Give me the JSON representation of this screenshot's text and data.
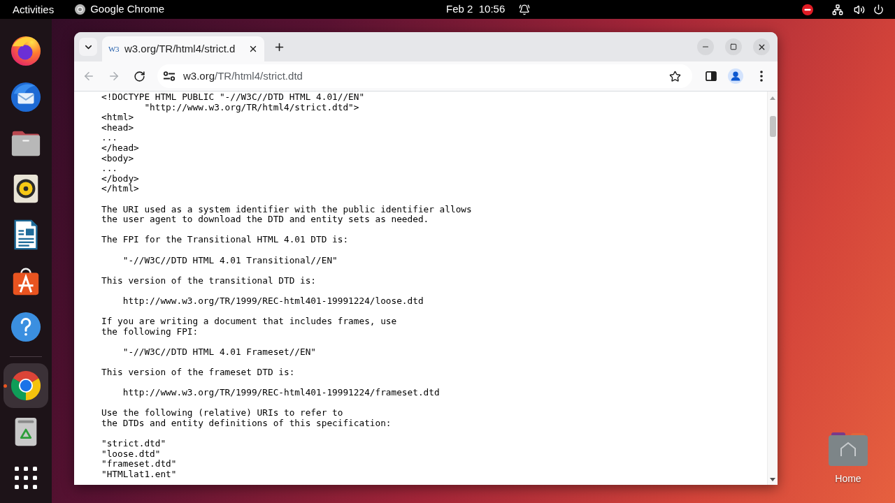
{
  "top_bar": {
    "activities": "Activities",
    "app_menu": "Google Chrome",
    "date": "Feb 2",
    "time": "10:56"
  },
  "dock": {
    "sections": [
      {
        "items": [
          {
            "kind": "fox_browser",
            "active": false
          },
          {
            "kind": "mail",
            "active": false
          },
          {
            "kind": "files",
            "active": false
          },
          {
            "kind": "music",
            "active": false
          },
          {
            "kind": "writer",
            "active": false
          },
          {
            "kind": "software",
            "active": false
          },
          {
            "kind": "help",
            "active": false
          }
        ]
      },
      {
        "items": [
          {
            "kind": "browser",
            "active": true
          },
          {
            "kind": "trash",
            "active": false
          },
          {
            "kind": "apps",
            "active": false
          }
        ]
      }
    ]
  },
  "browser": {
    "tabs": [
      {
        "favicon": "W3",
        "title": "w3.org/TR/html4/strict.d",
        "selected": true
      }
    ],
    "nav_buttons": [
      {
        "kind": "back",
        "disabled": true
      },
      {
        "kind": "forward",
        "disabled": true
      },
      {
        "kind": "reload",
        "disabled": false
      }
    ],
    "address_bar": {
      "host": "w3.org",
      "path": "/TR/html4/strict.dtd"
    },
    "document": {
      "blocks": [
        {
          "lines": [
            "<!DOCTYPE HTML PUBLIC \"-//W3C//DTD HTML 4.01//EN\"",
            "        \"http://www.w3.org/TR/html4/strict.dtd\">",
            "<html>",
            "<head>",
            "...",
            "</head>",
            "<body>",
            "...",
            "</body>",
            "</html>"
          ]
        },
        {
          "lines": [
            "The URI used as a system identifier with the public identifier allows",
            "the user agent to download the DTD and entity sets as needed."
          ]
        },
        {
          "lines": [
            "The FPI for the Transitional HTML 4.01 DTD is:"
          ]
        },
        {
          "lines": [
            "    \"-//W3C//DTD HTML 4.01 Transitional//EN\""
          ]
        },
        {
          "lines": [
            "This version of the transitional DTD is:"
          ]
        },
        {
          "lines": [
            "    http://www.w3.org/TR/1999/REC-html401-19991224/loose.dtd"
          ]
        },
        {
          "lines": [
            "If you are writing a document that includes frames, use",
            "the following FPI:"
          ]
        },
        {
          "lines": [
            "    \"-//W3C//DTD HTML 4.01 Frameset//EN\""
          ]
        },
        {
          "lines": [
            "This version of the frameset DTD is:"
          ]
        },
        {
          "lines": [
            "    http://www.w3.org/TR/1999/REC-html401-19991224/frameset.dtd"
          ]
        },
        {
          "lines": [
            "Use the following (relative) URIs to refer to",
            "the DTDs and entity definitions of this specification:"
          ]
        },
        {
          "lines": [
            "\"strict.dtd\"",
            "\"loose.dtd\"",
            "\"frameset.dtd\"",
            "\"HTMLlat1.ent\""
          ]
        }
      ]
    }
  },
  "desktop_icons": [
    {
      "label": "Home"
    }
  ]
}
